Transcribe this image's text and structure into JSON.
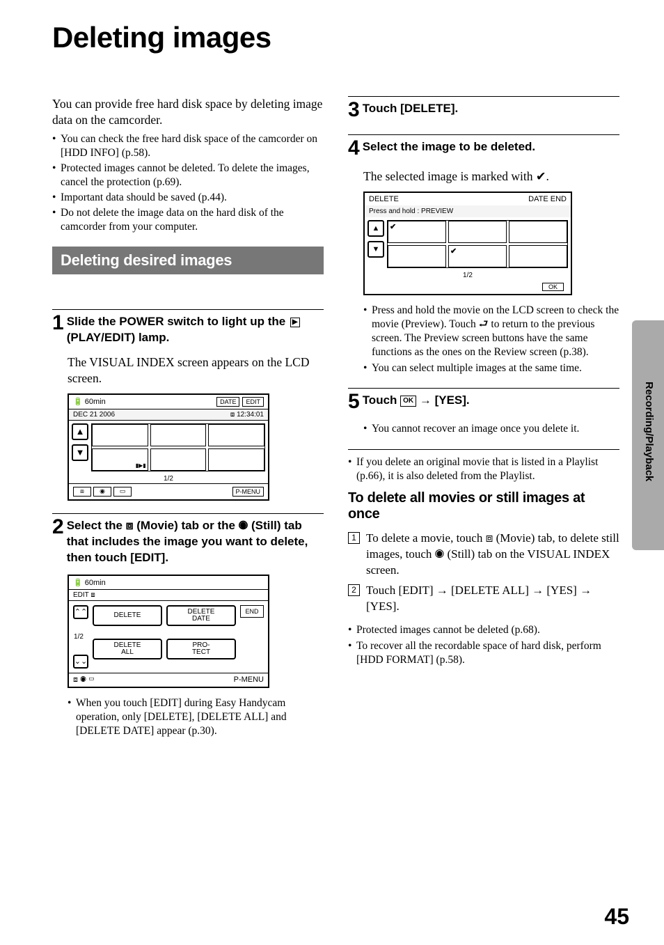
{
  "page": {
    "title": "Deleting images",
    "sideTab": "Recording/Playback",
    "pageNumber": "45"
  },
  "col1": {
    "intro": "You can provide free hard disk space by deleting image data on the camcorder.",
    "bullets": [
      "You can check the free hard disk space of the camcorder on [HDD INFO] (p.58).",
      "Protected images cannot be deleted. To delete the images, cancel the protection (p.69).",
      "Important data should be saved (p.44).",
      "Do not delete the image data on the hard disk of the camcorder from your computer."
    ],
    "sectionHeading": "Deleting desired images",
    "step1": {
      "num": "1",
      "titleA": "Slide the POWER switch to light up the ",
      "playEditIconAlt": "▶",
      "titleB": " (PLAY/EDIT) lamp.",
      "body": "The VISUAL INDEX screen appears on the LCD screen."
    },
    "screen1": {
      "battery": "60min",
      "btnDate": "DATE",
      "btnEdit": "EDIT",
      "dateText": "DEC 21 2006",
      "timeText": "12:34:01",
      "pager": "1/2",
      "pmenu": "P-MENU"
    },
    "step2": {
      "num": "2",
      "titleA": "Select the ",
      "movieIconAlt": "⧈",
      "titleB": " (Movie) tab or the ",
      "stillIconAlt": "◉",
      "titleC": " (Still) tab that includes the image you want to delete, then touch [EDIT]."
    },
    "screen2": {
      "battery": "60min",
      "edit": "EDIT",
      "pnum": "1/2",
      "btns": {
        "delete": "DELETE",
        "deleteDate": "DELETE\nDATE",
        "deleteAll": "DELETE\nALL",
        "protect": "PRO-\nTECT"
      },
      "end": "END",
      "pmenu": "P-MENU"
    },
    "note": "When you touch [EDIT] during Easy Handycam operation, only [DELETE], [DELETE ALL] and [DELETE DATE] appear (p.30)."
  },
  "col2": {
    "step3": {
      "num": "3",
      "title": "Touch [DELETE]."
    },
    "step4": {
      "num": "4",
      "title": "Select the image to be deleted.",
      "bodyA": "The selected image is marked with ",
      "bodyB": "."
    },
    "screen3": {
      "delete": "DELETE",
      "btnDate": "DATE",
      "btnEnd": "END",
      "hint": "Press and hold : PREVIEW",
      "pager": "1/2",
      "ok": "OK"
    },
    "step4bullets": [
      "Press and hold the movie on the LCD screen to check the movie (Preview). Touch  ⮐  to return to the previous screen. The Preview screen buttons have the same functions as the ones on the Review screen (p.38).",
      "You can select multiple images at the same time."
    ],
    "step5": {
      "num": "5",
      "titleA": "Touch ",
      "ok": "OK",
      "titleB": " → [YES].",
      "bullet": "You cannot recover an image once you delete it."
    },
    "afterBullet": "If you delete an original movie that is listed in a Playlist (p.66), it is also deleted from the Playlist.",
    "subHeading": "To delete all movies or still images at once",
    "numList": [
      "To delete a movie, touch ⧈ (Movie) tab, to delete still images, touch ◉  (Still) tab on the VISUAL INDEX screen.",
      "Touch [EDIT] → [DELETE ALL] → [YES] → [YES]."
    ],
    "finalBullets": [
      "Protected images cannot be deleted (p.68).",
      "To recover all the recordable space of hard disk, perform [HDD FORMAT] (p.58)."
    ]
  }
}
